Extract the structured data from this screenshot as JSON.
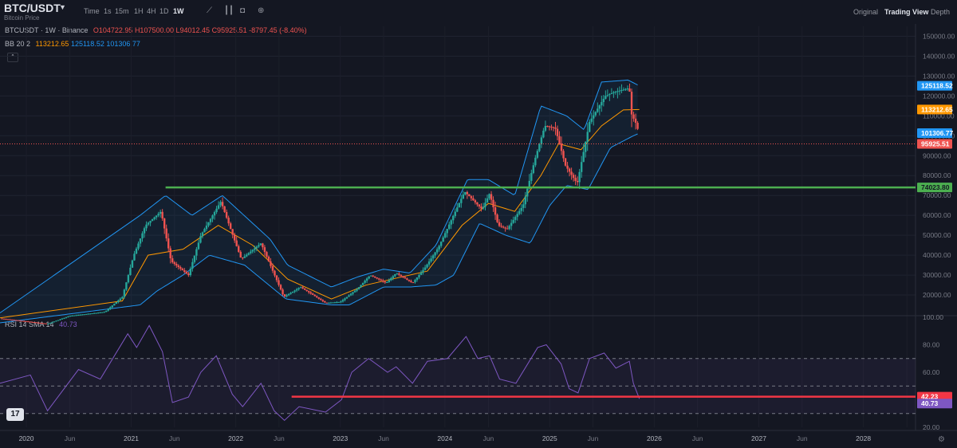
{
  "header": {
    "symbol": "BTC/USDT",
    "subtitle": "Bitcoin Price",
    "timeframes": [
      "Time",
      "1s",
      "15m",
      "1H",
      "4H",
      "1D",
      "1W"
    ],
    "active_timeframe": "1W",
    "icons": [
      "bar-style-icon",
      "candles-icon",
      "camera-icon",
      "add-icon"
    ],
    "views": [
      "Original",
      "Trading View",
      "Depth"
    ],
    "active_view": "Trading View"
  },
  "ohlc": {
    "name": "BTCUSDT · 1W · Binance",
    "o": "O104722.95",
    "h": "H107500.00",
    "l": "L94012.45",
    "c": "C95925.51",
    "chg": "-8797.45 (-8.40%)"
  },
  "bb_legend": {
    "name": "BB 20 2",
    "basis": "113212.65",
    "upper": "125118.52",
    "lower": "101306.77"
  },
  "rsi_legend": {
    "name": "RSI 14 SMA 14",
    "value": "40.73"
  },
  "colors": {
    "up": "#26a69a",
    "down": "#ef5350",
    "bb_upper": "#2196f3",
    "bb_basis": "#ff9800",
    "rsi": "#7e57c2",
    "support": "#4caf50",
    "rsi_line": "#f23645"
  },
  "chart_data": [
    {
      "type": "candlestick",
      "title": "BTCUSDT · 1W · Binance",
      "x_range": [
        "2019-10-01",
        "2028-07-01"
      ],
      "ylim": [
        10000,
        155000
      ],
      "y_ticks": [
        "150000.00",
        "140000.00",
        "130000.00",
        "120000.00",
        "110000.00",
        "100000.00",
        "90000.00",
        "80000.00",
        "70000.00",
        "60000.00",
        "50000.00",
        "40000.00",
        "30000.00",
        "20000.00"
      ],
      "x_ticks": [
        "2020",
        "Jun",
        "2021",
        "Jun",
        "2022",
        "Jun",
        "2023",
        "Jun",
        "2024",
        "Jun",
        "2025",
        "Jun",
        "2026",
        "Jun",
        "2027",
        "Jun",
        "2028"
      ],
      "price_path": [
        [
          "2019-10-01",
          8200
        ],
        [
          "2020-03-15",
          5500
        ],
        [
          "2020-06-01",
          9500
        ],
        [
          "2020-10-01",
          11500
        ],
        [
          "2020-12-01",
          19000
        ],
        [
          "2021-01-10",
          40000
        ],
        [
          "2021-02-20",
          55000
        ],
        [
          "2021-04-15",
          62000
        ],
        [
          "2021-05-20",
          37000
        ],
        [
          "2021-07-20",
          30000
        ],
        [
          "2021-09-01",
          50000
        ],
        [
          "2021-11-10",
          67000
        ],
        [
          "2022-01-20",
          38000
        ],
        [
          "2022-03-30",
          46000
        ],
        [
          "2022-06-18",
          19000
        ],
        [
          "2022-08-15",
          24000
        ],
        [
          "2022-11-10",
          16000
        ],
        [
          "2023-01-01",
          16500
        ],
        [
          "2023-03-01",
          23000
        ],
        [
          "2023-04-15",
          30000
        ],
        [
          "2023-06-10",
          26000
        ],
        [
          "2023-07-15",
          31000
        ],
        [
          "2023-09-10",
          26000
        ],
        [
          "2023-10-25",
          34000
        ],
        [
          "2023-12-10",
          44000
        ],
        [
          "2024-03-10",
          72000
        ],
        [
          "2024-05-10",
          63000
        ],
        [
          "2024-06-05",
          71000
        ],
        [
          "2024-07-05",
          55000
        ],
        [
          "2024-08-05",
          53000
        ],
        [
          "2024-09-30",
          65000
        ],
        [
          "2024-11-10",
          88000
        ],
        [
          "2024-12-15",
          105000
        ],
        [
          "2025-01-20",
          104000
        ],
        [
          "2025-02-25",
          85000
        ],
        [
          "2025-04-07",
          76000
        ],
        [
          "2025-05-20",
          107000
        ],
        [
          "2025-07-14",
          120000
        ],
        [
          "2025-08-15",
          122000
        ],
        [
          "2025-10-06",
          124000
        ],
        [
          "2025-10-13",
          111000
        ],
        [
          "2025-11-03",
          104722
        ],
        [
          "2025-11-10",
          95925
        ]
      ],
      "bollinger": {
        "period": 20,
        "stddev": 2,
        "basis_last": 113212.65,
        "upper_last": 125118.52,
        "lower_last": 101306.77,
        "upper_path": [
          [
            "2019-10-01",
            11000
          ],
          [
            "2021-02-01",
            60000
          ],
          [
            "2021-05-01",
            70000
          ],
          [
            "2021-08-01",
            60000
          ],
          [
            "2021-11-15",
            70000
          ],
          [
            "2022-05-01",
            48000
          ],
          [
            "2022-07-01",
            35000
          ],
          [
            "2022-12-01",
            24000
          ],
          [
            "2023-03-01",
            29000
          ],
          [
            "2023-06-01",
            33000
          ],
          [
            "2023-09-01",
            31000
          ],
          [
            "2023-12-01",
            45000
          ],
          [
            "2024-03-20",
            78000
          ],
          [
            "2024-06-01",
            78000
          ],
          [
            "2024-09-01",
            70000
          ],
          [
            "2024-12-01",
            115000
          ],
          [
            "2025-03-01",
            110000
          ],
          [
            "2025-05-01",
            103000
          ],
          [
            "2025-07-01",
            127000
          ],
          [
            "2025-10-01",
            128000
          ],
          [
            "2025-11-10",
            125118
          ]
        ],
        "lower_path": [
          [
            "2019-10-01",
            6000
          ],
          [
            "2021-02-01",
            15000
          ],
          [
            "2021-04-01",
            22000
          ],
          [
            "2021-07-01",
            30000
          ],
          [
            "2021-10-01",
            40000
          ],
          [
            "2022-02-01",
            35000
          ],
          [
            "2022-06-25",
            18000
          ],
          [
            "2022-12-01",
            15000
          ],
          [
            "2023-02-01",
            15000
          ],
          [
            "2023-06-01",
            24000
          ],
          [
            "2023-09-01",
            24000
          ],
          [
            "2023-12-01",
            25000
          ],
          [
            "2024-02-01",
            30000
          ],
          [
            "2024-05-01",
            56000
          ],
          [
            "2024-08-01",
            50000
          ],
          [
            "2024-10-25",
            46000
          ],
          [
            "2025-01-01",
            65000
          ],
          [
            "2025-03-01",
            75000
          ],
          [
            "2025-05-15",
            73000
          ],
          [
            "2025-08-01",
            94000
          ],
          [
            "2025-10-20",
            100000
          ],
          [
            "2025-11-10",
            101306
          ]
        ],
        "basis_path": [
          [
            "2019-10-01",
            8500
          ],
          [
            "2020-12-01",
            17000
          ],
          [
            "2021-03-01",
            40000
          ],
          [
            "2021-07-01",
            43000
          ],
          [
            "2021-11-01",
            55000
          ],
          [
            "2022-03-01",
            45000
          ],
          [
            "2022-07-01",
            28000
          ],
          [
            "2022-12-01",
            18000
          ],
          [
            "2023-04-01",
            25000
          ],
          [
            "2023-08-01",
            29000
          ],
          [
            "2023-11-01",
            32000
          ],
          [
            "2024-03-01",
            55000
          ],
          [
            "2024-06-01",
            66000
          ],
          [
            "2024-09-01",
            62000
          ],
          [
            "2024-12-01",
            80000
          ],
          [
            "2025-02-01",
            96000
          ],
          [
            "2025-04-20",
            93000
          ],
          [
            "2025-07-01",
            105000
          ],
          [
            "2025-09-15",
            113000
          ],
          [
            "2025-11-10",
            113212
          ]
        ]
      },
      "horizontal_levels": [
        {
          "value": 74023.8,
          "label": "74023.80",
          "from": "2021-05-01"
        }
      ],
      "price_labels": [
        {
          "value": 125118.52,
          "label": "125118.52",
          "series": "upper"
        },
        {
          "value": 113212.65,
          "label": "113212.65",
          "series": "basis"
        },
        {
          "value": 101306.77,
          "label": "101306.77",
          "series": "lower"
        },
        {
          "value": 95925.51,
          "label": "95925.51",
          "series": "last"
        }
      ]
    },
    {
      "type": "line",
      "title": "RSI 14 SMA 14",
      "ylim": [
        20,
        100
      ],
      "y_ticks": [
        "100.00",
        "80.00",
        "60.00",
        "20.00"
      ],
      "bands": [
        70,
        50,
        30
      ],
      "rsi_path": [
        [
          "2019-10-01",
          52
        ],
        [
          "2020-01-15",
          58
        ],
        [
          "2020-03-15",
          32
        ],
        [
          "2020-07-01",
          62
        ],
        [
          "2020-09-15",
          55
        ],
        [
          "2020-12-20",
          88
        ],
        [
          "2021-01-20",
          78
        ],
        [
          "2021-03-05",
          94
        ],
        [
          "2021-04-20",
          75
        ],
        [
          "2021-05-25",
          38
        ],
        [
          "2021-07-20",
          42
        ],
        [
          "2021-09-01",
          60
        ],
        [
          "2021-10-25",
          72
        ],
        [
          "2021-12-20",
          44
        ],
        [
          "2022-01-25",
          35
        ],
        [
          "2022-03-30",
          52
        ],
        [
          "2022-05-15",
          32
        ],
        [
          "2022-06-20",
          25
        ],
        [
          "2022-08-10",
          35
        ],
        [
          "2022-11-10",
          31
        ],
        [
          "2023-01-05",
          40
        ],
        [
          "2023-02-10",
          60
        ],
        [
          "2023-04-10",
          70
        ],
        [
          "2023-06-15",
          60
        ],
        [
          "2023-07-15",
          64
        ],
        [
          "2023-09-10",
          52
        ],
        [
          "2023-11-01",
          68
        ],
        [
          "2024-01-10",
          70
        ],
        [
          "2024-03-15",
          86
        ],
        [
          "2024-04-25",
          70
        ],
        [
          "2024-06-05",
          72
        ],
        [
          "2024-07-10",
          55
        ],
        [
          "2024-09-05",
          52
        ],
        [
          "2024-11-20",
          78
        ],
        [
          "2024-12-20",
          80
        ],
        [
          "2025-02-10",
          66
        ],
        [
          "2025-03-10",
          48
        ],
        [
          "2025-04-10",
          45
        ],
        [
          "2025-05-20",
          70
        ],
        [
          "2025-07-10",
          74
        ],
        [
          "2025-08-20",
          63
        ],
        [
          "2025-10-06",
          68
        ],
        [
          "2025-10-20",
          52
        ],
        [
          "2025-11-10",
          40.73
        ]
      ],
      "sma_last": 42.23,
      "horizontal_level": {
        "value": 42.23,
        "from": "2022-07-15"
      },
      "price_labels": [
        {
          "value": 42.23,
          "label": "42.23"
        },
        {
          "value": 40.73,
          "label": "40.73"
        }
      ]
    }
  ]
}
